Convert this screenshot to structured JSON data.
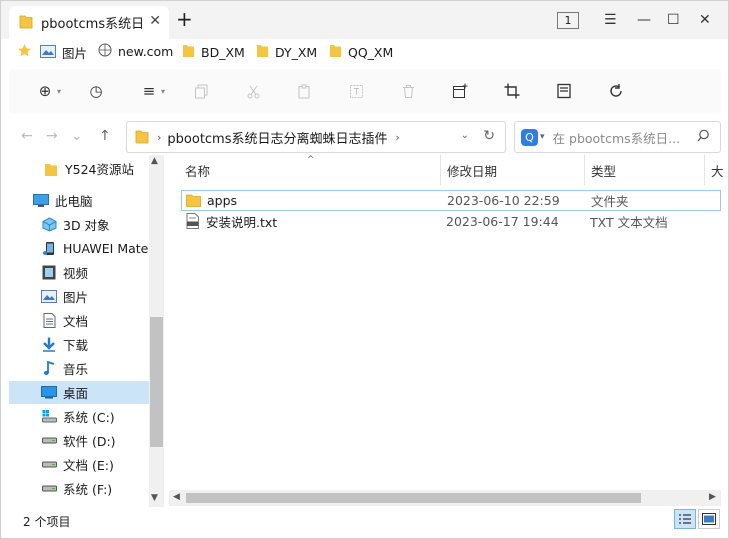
{
  "titlebar": {
    "tab_title": "pbootcms系统日",
    "tab_count": "1",
    "close_tab_glyph": "✕",
    "new_tab_glyph": "+",
    "menu_glyph": "☰",
    "minimize_glyph": "—",
    "maximize_glyph": "☐",
    "close_glyph": "✕"
  },
  "bookmarks": [
    {
      "label": "图片",
      "icon": "picture-icon"
    },
    {
      "label": "new.com",
      "icon": "globe-icon"
    },
    {
      "label": "BD_XM",
      "icon": "folder-icon"
    },
    {
      "label": "DY_XM",
      "icon": "folder-icon"
    },
    {
      "label": "QQ_XM",
      "icon": "folder-icon"
    }
  ],
  "toolbar": {
    "new_glyph": "⊕",
    "history_glyph": "◷",
    "view_glyph": "≡",
    "caret_glyph": "▾"
  },
  "address": {
    "path": "pbootcms系统日志分离蜘蛛日志插件b...",
    "sep": "›",
    "dropdown_glyph": "⌄",
    "refresh_glyph": "↻"
  },
  "search": {
    "placeholder": "在 pbootcms系统日...",
    "badge": "Q",
    "caret": "▾",
    "magnify_glyph": "⌕"
  },
  "nav": {
    "back": "←",
    "forward": "→",
    "up": "↑"
  },
  "sidebar": {
    "items": [
      {
        "label": "Y524资源站",
        "icon": "folder-icon"
      },
      {
        "label": "此电脑",
        "icon": "computer-icon"
      },
      {
        "label": "3D 对象",
        "icon": "cube-icon"
      },
      {
        "label": "HUAWEI Mate",
        "icon": "phone-icon"
      },
      {
        "label": "视频",
        "icon": "video-icon"
      },
      {
        "label": "图片",
        "icon": "picture-icon"
      },
      {
        "label": "文档",
        "icon": "document-icon"
      },
      {
        "label": "下载",
        "icon": "download-icon"
      },
      {
        "label": "音乐",
        "icon": "music-icon"
      },
      {
        "label": "桌面",
        "icon": "desktop-icon",
        "selected": true
      },
      {
        "label": "系统 (C:)",
        "icon": "drive-icon"
      },
      {
        "label": "软件 (D:)",
        "icon": "drive-icon"
      },
      {
        "label": "文档 (E:)",
        "icon": "drive-icon"
      },
      {
        "label": "系统 (F:)",
        "icon": "drive-icon"
      }
    ]
  },
  "list": {
    "columns": {
      "name": "名称",
      "modified": "修改日期",
      "type": "类型",
      "size": "大"
    },
    "sort_glyph": "^",
    "rows": [
      {
        "name": "apps",
        "modified": "2023-06-10 22:59",
        "type": "文件夹",
        "icon": "folder-icon"
      },
      {
        "name": "安装说明.txt",
        "modified": "2023-06-17 19:44",
        "type": "TXT 文本文档",
        "icon": "text-file-icon"
      }
    ]
  },
  "scroll": {
    "up": "▲",
    "down": "▼",
    "left": "◀",
    "right": "▶"
  },
  "status": {
    "count": "2 个项目"
  },
  "colors": {
    "folder": "#f5c542",
    "selection": "#cce4f7",
    "accent": "#2f7ee8"
  }
}
